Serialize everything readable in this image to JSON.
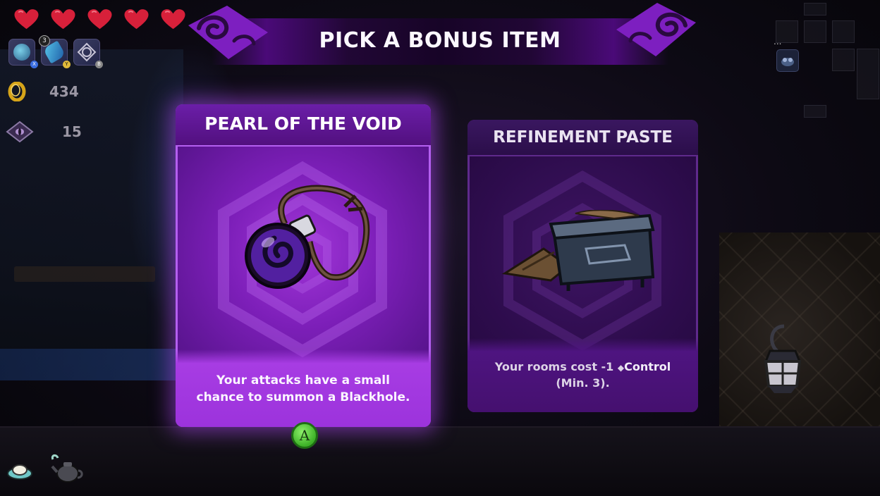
{
  "banner": {
    "title": "PICK A BONUS ITEM"
  },
  "hud": {
    "hearts": {
      "count": 5,
      "color": "#d7203a"
    },
    "items": [
      {
        "name": "blue-orb-item-icon",
        "button": "X"
      },
      {
        "name": "feather-item-icon",
        "button": "Y",
        "count": "3"
      },
      {
        "name": "rune-item-icon",
        "button": "B"
      }
    ],
    "gold": "434",
    "crystals": "15",
    "map_dots": "..."
  },
  "cards": [
    {
      "title": "PEARL OF THE VOID",
      "description_line1": "Your attacks have a small",
      "description_line2": "chance to summon a Blackhole.",
      "icon": "void-pearl-icon",
      "selected": true
    },
    {
      "title": "REFINEMENT PASTE",
      "description_prefix": "Your rooms cost -1",
      "description_keyword": "Control",
      "description_line2": "(Min. 3).",
      "icon": "paste-chest-icon",
      "selected": false
    }
  ],
  "prompt": {
    "button": "A"
  },
  "colors": {
    "selected_card": "#8a2bc8",
    "unselected_card": "#2d0c4c",
    "a_button": "#4fc235"
  }
}
